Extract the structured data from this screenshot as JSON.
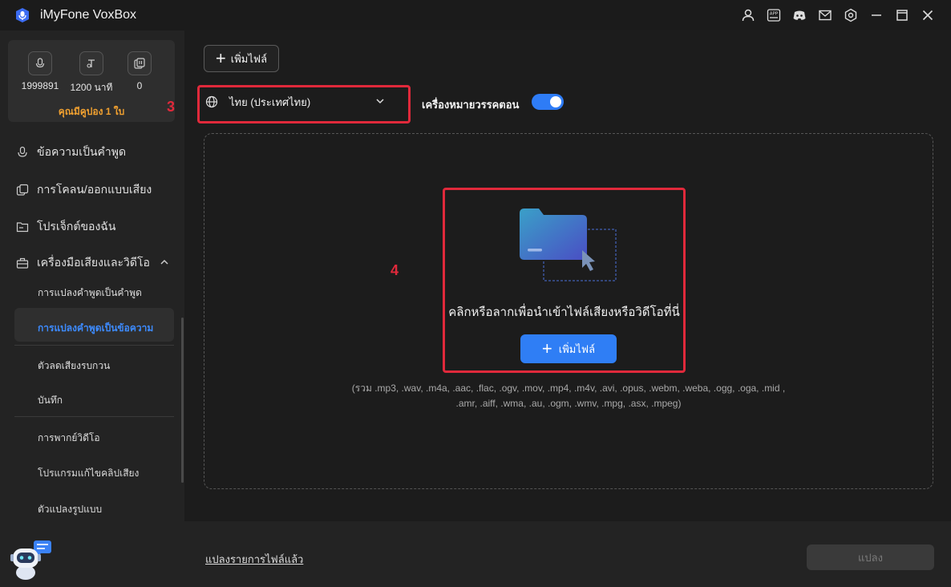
{
  "window": {
    "title": "iMyFone VoxBox"
  },
  "titlebar_icons": [
    "user-icon",
    "app-icon",
    "discord-icon",
    "mail-icon",
    "settings-icon",
    "minimize-icon",
    "maximize-icon",
    "close-icon"
  ],
  "titlebar_app_badge": "APP",
  "sidebar": {
    "stats": [
      {
        "icon": "voice-chars-icon",
        "value": "1999891"
      },
      {
        "icon": "minutes-icon",
        "value": "1200 นาที"
      },
      {
        "icon": "clone-count-icon",
        "value": "0"
      }
    ],
    "coupon": "คุณมีคูปอง 1 ใบ",
    "nav": [
      {
        "label": "ข้อความเป็นคำพูด"
      },
      {
        "label": "การโคลน/ออกแบบเสียง"
      },
      {
        "label": "โปรเจ็กต์ของฉัน"
      },
      {
        "label": "เครื่องมือเสียงและวิดีโอ"
      }
    ],
    "sub": [
      {
        "label": "การแปลงคำพูดเป็นคำพูด"
      },
      {
        "label": "การแปลงคำพูดเป็นข้อความ"
      },
      {
        "label": "ตัวลดเสียงรบกวน"
      },
      {
        "label": "บันทึก"
      },
      {
        "label": "การพากย์วิดีโอ"
      },
      {
        "label": "โปรแกรมแก้ไขคลิปเสียง"
      },
      {
        "label": "ตัวแปลงรูปแบบ"
      }
    ]
  },
  "main": {
    "add_file_label": "เพิ่มไฟล์",
    "language_select": "ไทย (ประเทศไทย)",
    "punctuation_label": "เครื่องหมายวรรคตอน",
    "punctuation_on": true,
    "marker_3": "3",
    "marker_4": "4",
    "drop_text": "คลิกหรือลากเพื่อนำเข้าไฟล์เสียงหรือวิดีโอที่นี่",
    "drop_button": "เพิ่มไฟล์",
    "formats_line1": "(รวม .mp3, .wav, .m4a, .aac, .flac, .ogv, .mov, .mp4, .m4v, .avi, .opus, .webm, .weba, .ogg, .oga, .mid ,",
    "formats_line2": ".amr, .aiff, .wma, .au, .ogm, .wmv, .mpg, .asx, .mpeg)"
  },
  "footer": {
    "history_link": "แปลงรายการไฟล์แล้ว",
    "convert_button": "แปลง"
  },
  "colors": {
    "accent": "#2f7ef5",
    "highlight": "#e0293b",
    "coupon": "#f0a030"
  }
}
